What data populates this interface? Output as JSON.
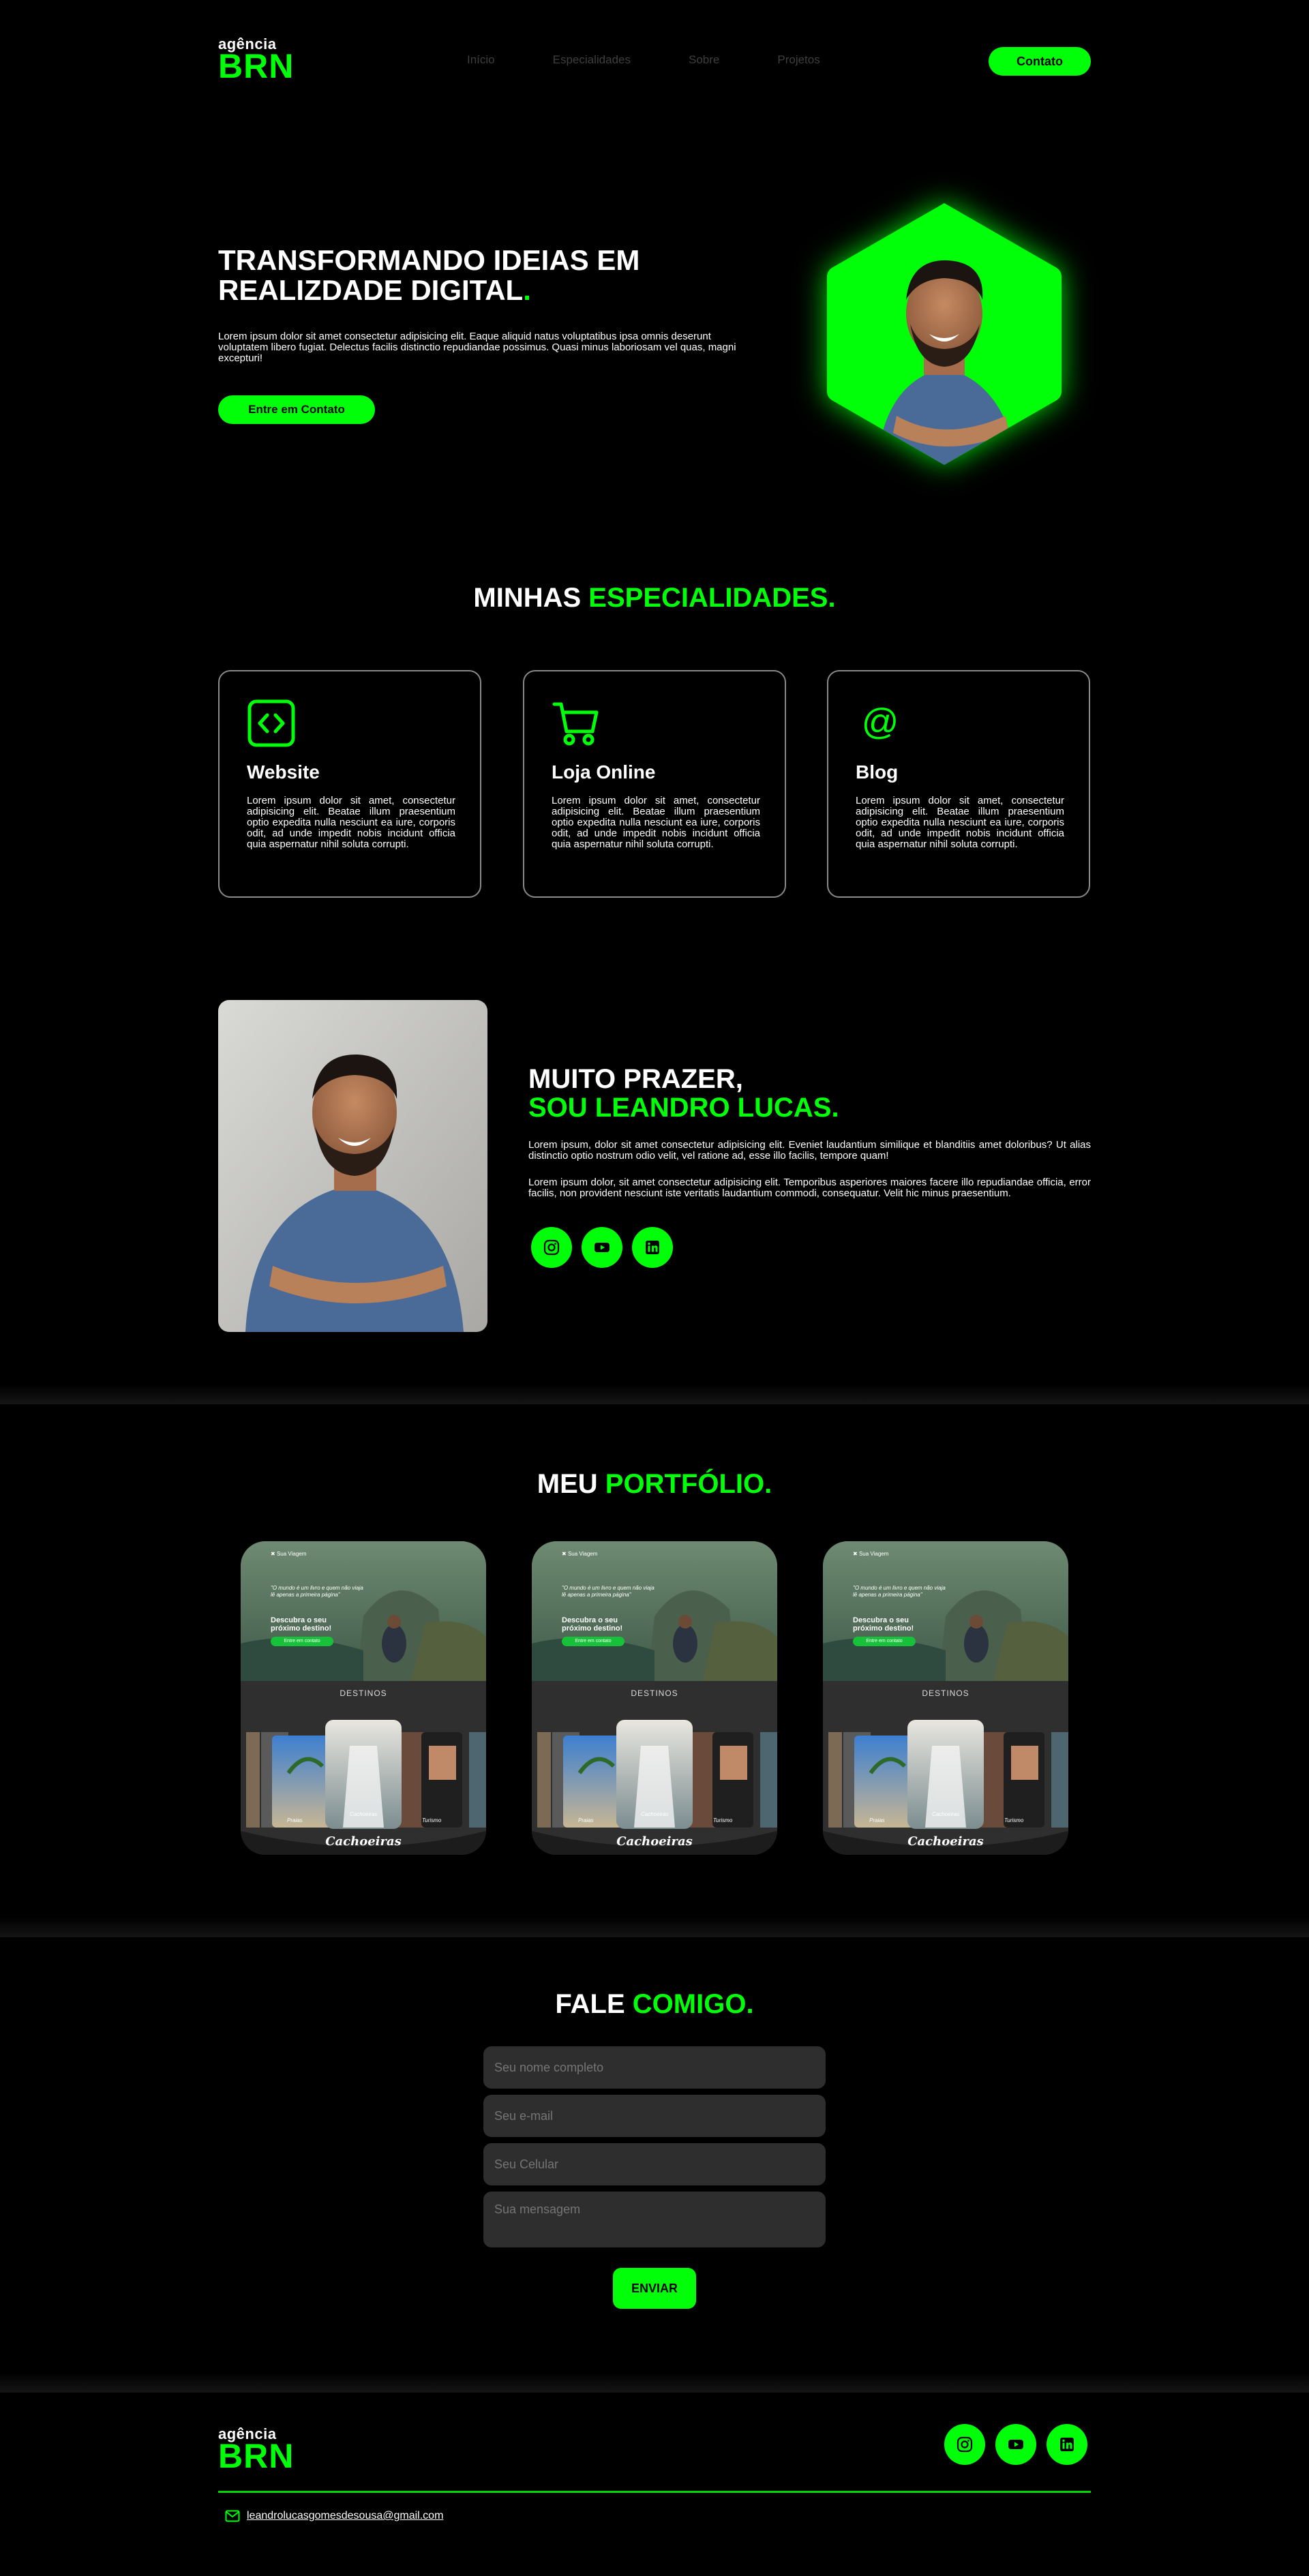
{
  "header": {
    "logo_top": "agência",
    "logo_bottom": "BRN",
    "nav": [
      "Início",
      "Especialidades",
      "Sobre",
      "Projetos"
    ],
    "cta": "Contato"
  },
  "hero": {
    "title_line1": "TRANSFORMANDO IDEIAS EM",
    "title_line2": "REALIZDADE DIGITAL",
    "title_dot": ".",
    "text": "Lorem ipsum dolor sit amet consectetur adipisicing elit. Eaque aliquid natus voluptatibus ipsa omnis deserunt voluptatem libero fugiat. Delectus facilis distinctio repudiandae possimus. Quasi minus laboriosam vel quas, magni excepturi!",
    "button": "Entre em Contato"
  },
  "specialties": {
    "title_white": "MINHAS",
    "title_green": "ESPECIALIDADES.",
    "cards": [
      {
        "icon": "code-icon",
        "title": "Website",
        "text": "Lorem ipsum dolor sit amet, consectetur adipisicing elit. Beatae illum praesentium optio expedita nulla nesciunt ea iure, corporis odit, ad unde impedit nobis incidunt officia quia aspernatur nihil soluta corrupti."
      },
      {
        "icon": "cart-icon",
        "title": "Loja Online",
        "text": "Lorem ipsum dolor sit amet, consectetur adipisicing elit. Beatae illum praesentium optio expedita nulla nesciunt ea iure, corporis odit, ad unde impedit nobis incidunt officia quia aspernatur nihil soluta corrupti."
      },
      {
        "icon": "at-icon",
        "title": "Blog",
        "text": "Lorem ipsum dolor sit amet, consectetur adipisicing elit. Beatae illum praesentium optio expedita nulla nesciunt ea iure, corporis odit, ad unde impedit nobis incidunt officia quia aspernatur nihil soluta corrupti."
      }
    ]
  },
  "about": {
    "title_white": "MUITO PRAZER,",
    "title_green": "SOU LEANDRO LUCAS.",
    "p1": "Lorem ipsum, dolor sit amet consectetur adipisicing elit. Eveniet laudantium similique et blanditiis amet doloribus? Ut alias distinctio optio nostrum odio velit, vel ratione ad, esse illo facilis, tempore quam!",
    "p2": "Lorem ipsum dolor, sit amet consectetur adipisicing elit. Temporibus asperiores maiores facere illo repudiandae officia, error facilis, non provident nesciunt iste veritatis laudantium commodi, consequatur. Velit hic minus praesentium.",
    "social": [
      "instagram-icon",
      "youtube-icon",
      "linkedin-icon"
    ]
  },
  "portfolio": {
    "title_white": "MEU",
    "title_green": "PORTFÓLIO.",
    "items": [
      {
        "brand": "Sua Viagem",
        "quote": "\"O mundo é um livro e quem não viaja lê apenas a primeira página\"",
        "headline": "Descubra o seu próximo destino!",
        "button": "Entre em contato",
        "section": "DESTINOS",
        "labels": [
          "Praias",
          "Cachoeiras",
          "Turismo"
        ],
        "caption": "Cachoeiras"
      },
      {
        "brand": "Sua Viagem",
        "quote": "\"O mundo é um livro e quem não viaja lê apenas a primeira página\"",
        "headline": "Descubra o seu próximo destino!",
        "button": "Entre em contato",
        "section": "DESTINOS",
        "labels": [
          "Praias",
          "Cachoeiras",
          "Turismo"
        ],
        "caption": "Cachoeiras"
      },
      {
        "brand": "Sua Viagem",
        "quote": "\"O mundo é um livro e quem não viaja lê apenas a primeira página\"",
        "headline": "Descubra o seu próximo destino!",
        "button": "Entre em contato",
        "section": "DESTINOS",
        "labels": [
          "Praias",
          "Cachoeiras",
          "Turismo"
        ],
        "caption": "Cachoeiras"
      }
    ]
  },
  "contact": {
    "title_white": "FALE",
    "title_green": "COMIGO.",
    "name_placeholder": "Seu nome completo",
    "email_placeholder": "Seu e-mail",
    "phone_placeholder": "Seu Celular",
    "message_placeholder": "Sua mensagem",
    "button": "ENVIAR"
  },
  "footer": {
    "logo_top": "agência",
    "logo_bottom": "BRN",
    "email": "leandrolucasgomesdesousa@gmail.com"
  },
  "colors": {
    "accent": "#00ff08",
    "background": "#000000",
    "input": "#2e2e2e"
  }
}
